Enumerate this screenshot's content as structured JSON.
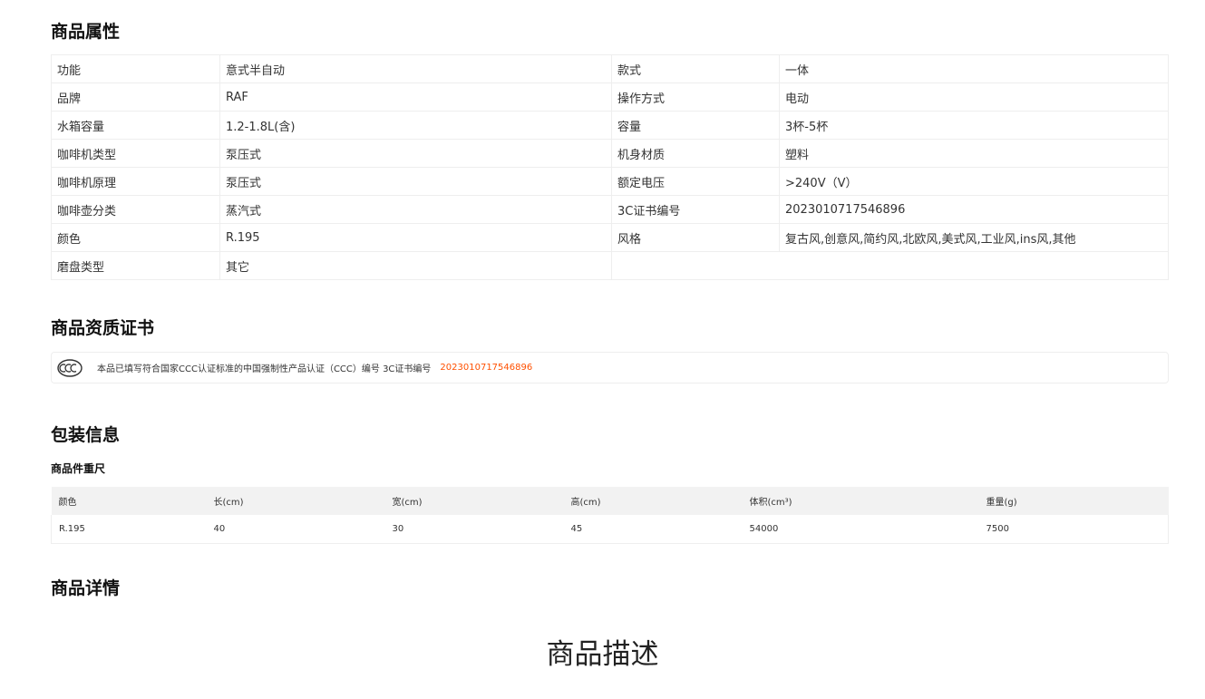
{
  "sections": {
    "attributes_title": "商品属性",
    "certificate_title": "商品资质证书",
    "packaging_title": "包装信息",
    "details_title": "商品详情"
  },
  "attributes": [
    {
      "key": "功能",
      "value": "意式半自动",
      "key2": "款式",
      "value2": "一体"
    },
    {
      "key": "品牌",
      "value": "RAF",
      "key2": "操作方式",
      "value2": "电动"
    },
    {
      "key": "水箱容量",
      "value": "1.2-1.8L(含)",
      "key2": "容量",
      "value2": "3杯-5杯"
    },
    {
      "key": "咖啡机类型",
      "value": "泵压式",
      "key2": "机身材质",
      "value2": "塑料"
    },
    {
      "key": "咖啡机原理",
      "value": "泵压式",
      "key2": "额定电压",
      "value2": ">240V（V）"
    },
    {
      "key": "咖啡壶分类",
      "value": "蒸汽式",
      "key2": "3C证书编号",
      "value2": "2023010717546896"
    },
    {
      "key": "颜色",
      "value": "R.195",
      "key2": "风格",
      "value2": "复古风,创意风,简约风,北欧风,美式风,工业风,ins风,其他"
    },
    {
      "key": "磨盘类型",
      "value": "其它",
      "key2": "",
      "value2": ""
    }
  ],
  "certificate": {
    "logo_icon": "ccc-logo-icon",
    "text": "本品已填写符合国家CCC认证标准的中国强制性产品认证（CCC）编号 3C证书编号",
    "number": "2023010717546896",
    "number_color": "#ff5000"
  },
  "packaging": {
    "subtitle": "商品件重尺",
    "headers": [
      "颜色",
      "长(cm)",
      "宽(cm)",
      "高(cm)",
      "体积(cm³)",
      "重量(g)"
    ],
    "rows": [
      [
        "R.195",
        "40",
        "30",
        "45",
        "54000",
        "7500"
      ]
    ]
  },
  "details": {
    "banner": "商品描述"
  }
}
